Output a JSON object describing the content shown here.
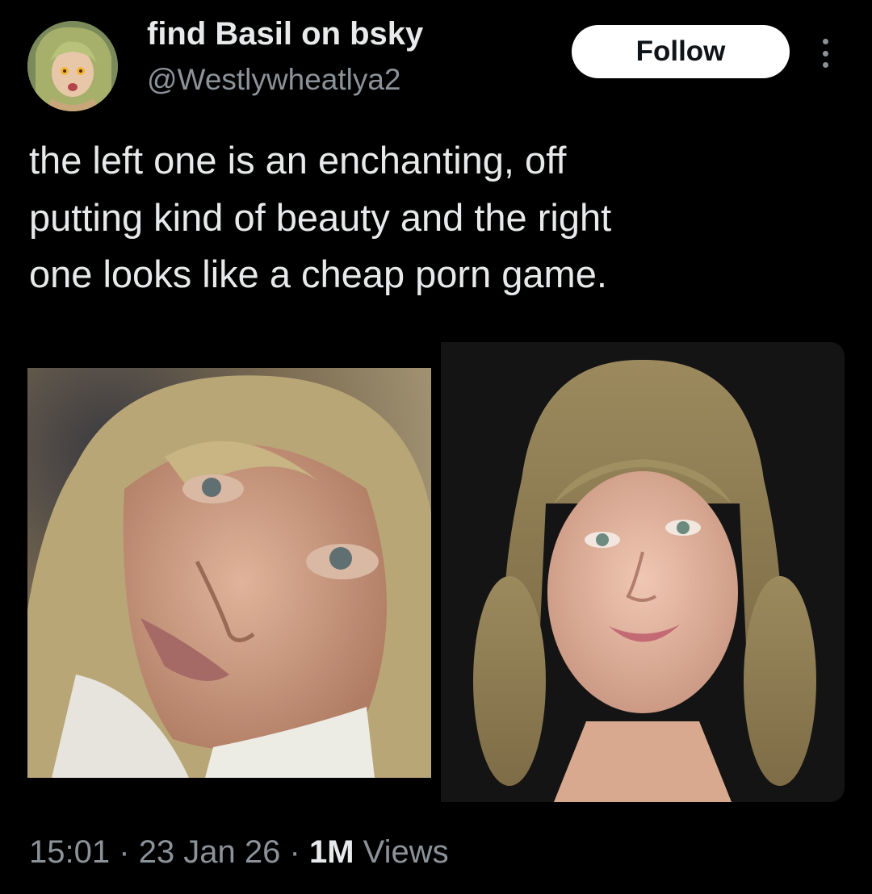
{
  "author": {
    "display_name": "find Basil on bsky",
    "handle": "@Westlywheatlya2",
    "avatar_icon": "avatar-illustration"
  },
  "actions": {
    "follow_label": "Follow",
    "more_icon": "more-vertical-icon"
  },
  "tweet": {
    "text_lines": [
      "the left one is an enchanting, off",
      "putting kind of beauty and the right",
      "one looks like a cheap porn game."
    ]
  },
  "media": {
    "images": [
      "left-portrait-photo",
      "right-portrait-render"
    ]
  },
  "meta": {
    "time": "15:01",
    "separator": "·",
    "date": "23 Jan 26",
    "views_count": "1M",
    "views_label": "Views"
  },
  "colors": {
    "background": "#000000",
    "primary_text": "#e7e9ea",
    "secondary_text": "#8b9299",
    "follow_bg": "#ffffff"
  }
}
